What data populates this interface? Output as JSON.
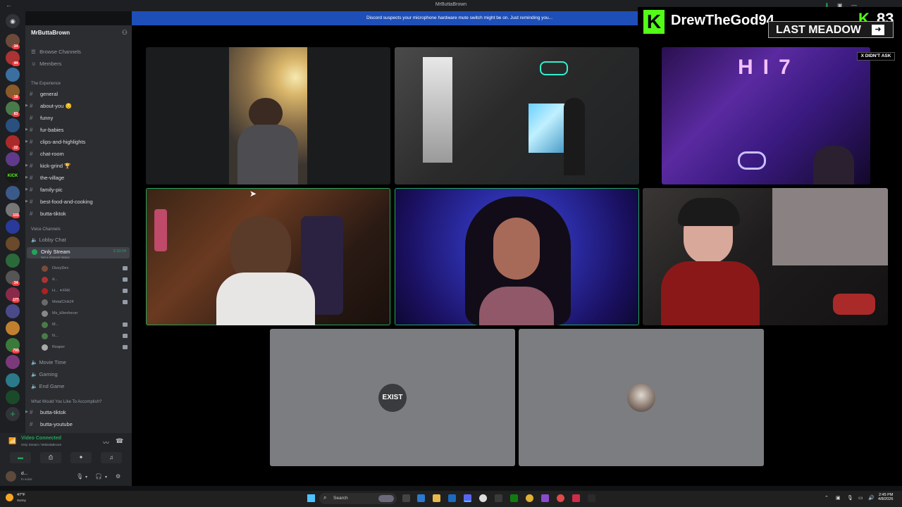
{
  "titlebar": {
    "title": "MrButtaBrown"
  },
  "banner": {
    "text": "Discord suspects your microphone hardware mute switch might be on. Just reminding you..."
  },
  "server": {
    "name": "MrButtaBrown",
    "nav": [
      "Browse Channels",
      "Members"
    ],
    "category_text": "The Experience",
    "text_channels": [
      "general",
      "about-you 😔",
      "funny",
      "fur-babies",
      "clips-and-highlights",
      "chat-room",
      "kick-grind 🏆",
      "the-village",
      "family-pic",
      "best-food-and-cooking",
      "butta-tiktok"
    ],
    "category_voice": "Voice Channels",
    "voice_channels": [
      {
        "name": "Lobby Chat"
      },
      {
        "name": "Only Stream",
        "timer": "2:10:24",
        "status": "Set a channel status"
      }
    ],
    "voice_members": [
      "DizzyDev",
      "d...",
      "H... ✦FRK",
      "MetalChik24",
      "Ms_k9enforcer",
      "M...",
      "N...",
      "Reaper"
    ],
    "voice_channels_2": [
      "Movie Time",
      "Gaming",
      "End Game"
    ],
    "category_accomplish": "What Would You Like To Accomplish?",
    "extra_channels": [
      "butta-tiktok",
      "butta-youtube"
    ]
  },
  "voicebar": {
    "title": "Video Connected",
    "subtitle": "Only Stream / MrButtaBrown"
  },
  "userbar": {
    "name": "d...",
    "status": "In voice"
  },
  "rail": {
    "badges": [
      "34",
      "44",
      "18",
      "83",
      "22",
      "103",
      "34",
      "177",
      "793"
    ]
  },
  "overlay": {
    "logo_letter": "K",
    "streamer": "DrewTheGod94",
    "viewer_count": "83",
    "song": "LAST MEADOW",
    "tag": "X DIDN'T ASK"
  },
  "stage": {
    "tiles": [
      {
        "id": "webcam-1",
        "speaking": false
      },
      {
        "id": "webcam-2",
        "speaking": false
      },
      {
        "id": "webcam-3",
        "speaking": false
      },
      {
        "id": "webcam-4",
        "speaking": true
      },
      {
        "id": "webcam-5",
        "speaking": true
      },
      {
        "id": "webcam-6",
        "speaking": false
      },
      {
        "id": "avatar-exist",
        "label": "EXIST"
      },
      {
        "id": "avatar-2",
        "label": ""
      }
    ]
  },
  "taskbar": {
    "weather_temp": "47°F",
    "weather_desc": "Sunny",
    "search": "Search",
    "time": "2:45 PM",
    "date": "4/8/2026"
  },
  "colors": {
    "accent": "#5865f2",
    "online": "#23a559",
    "banner": "#1e4fb8",
    "kick": "#53fc18"
  }
}
